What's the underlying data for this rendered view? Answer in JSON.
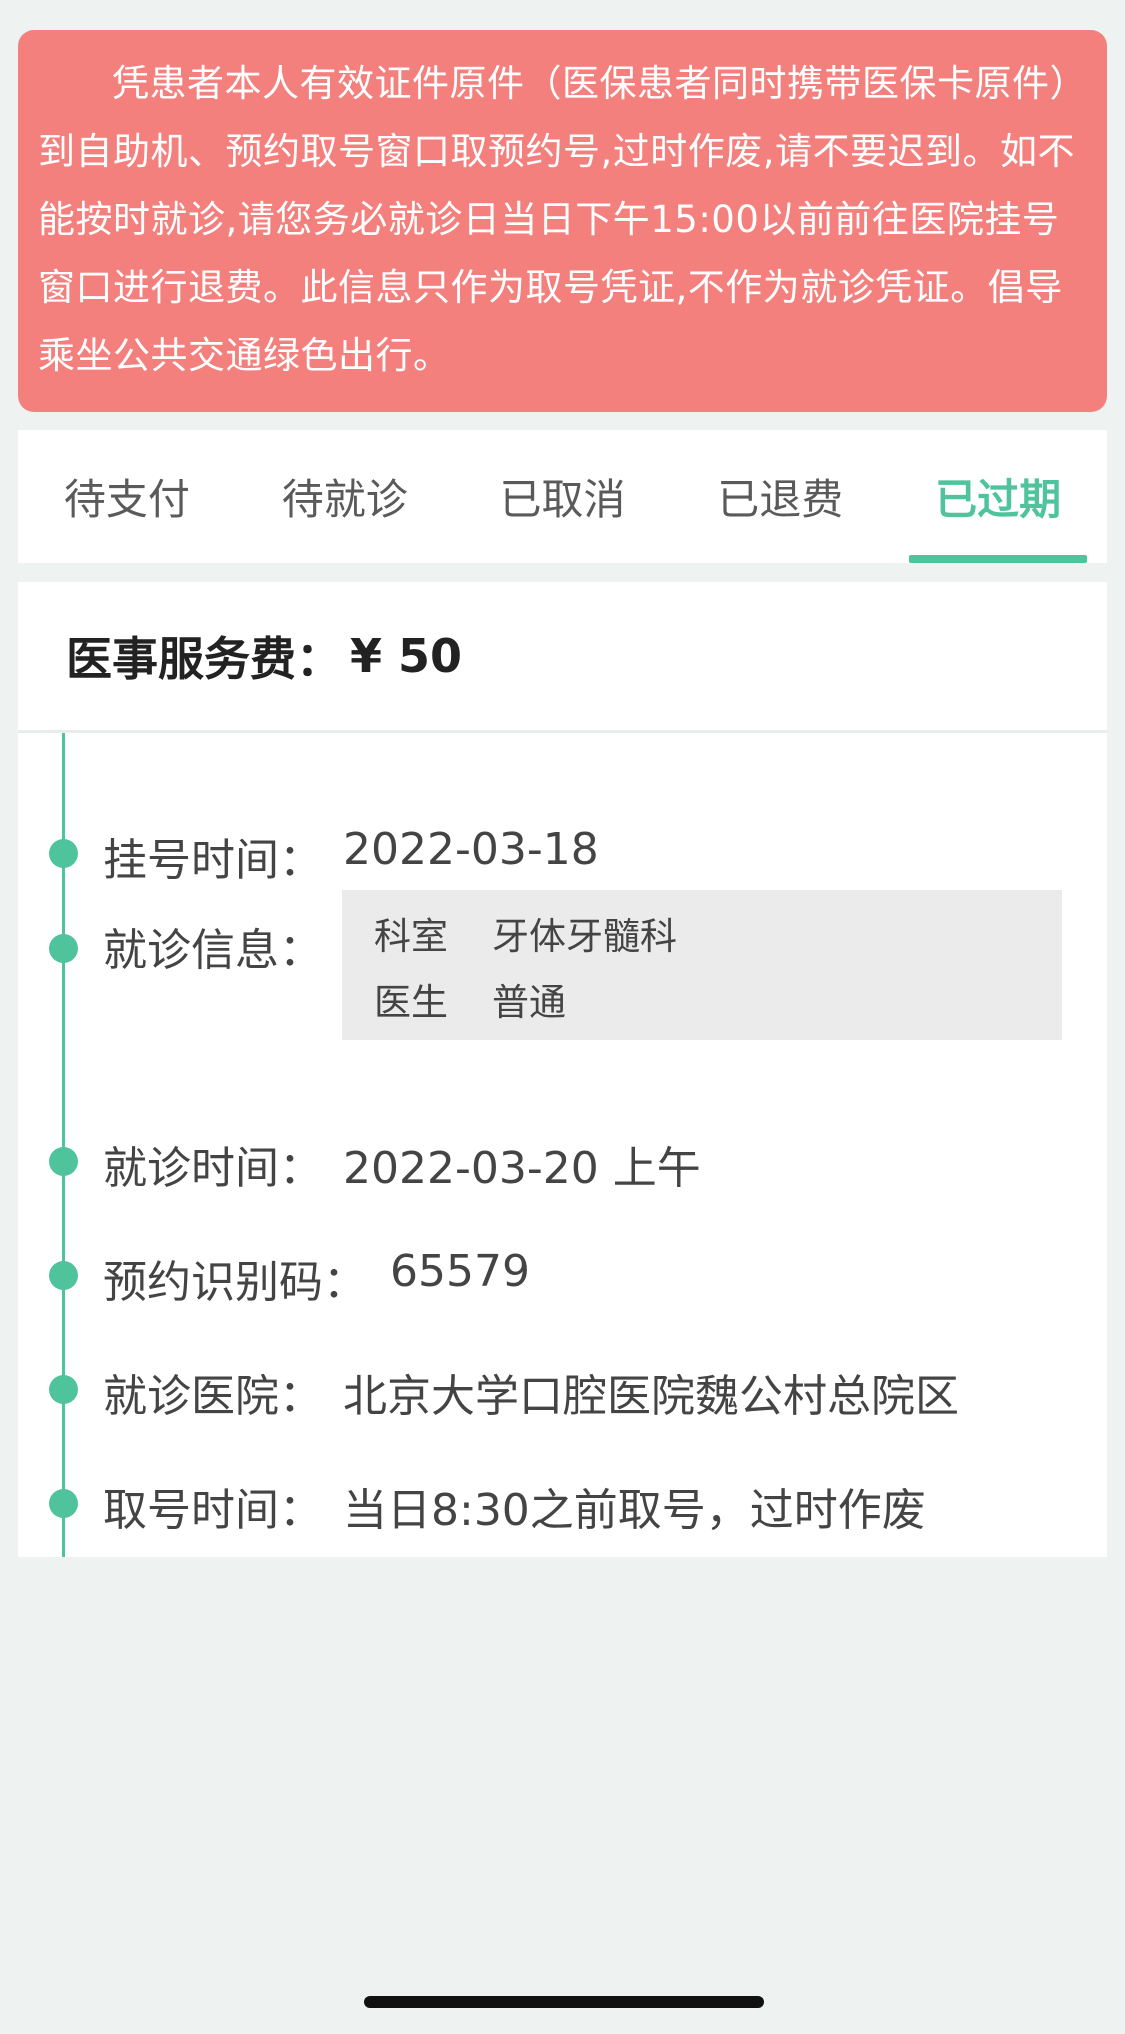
{
  "notice": {
    "text": "凭患者本人有效证件原件（医保患者同时携带医保卡原件）到自助机、预约取号窗口取预约号,过时作废,请不要迟到。如不能按时就诊,请您务必就诊日当日下午15:00以前前往医院挂号窗口进行退费。此信息只作为取号凭证,不作为就诊凭证。倡导乘坐公共交通绿色出行。"
  },
  "tabs": [
    {
      "label": "待支付",
      "active": false
    },
    {
      "label": "待就诊",
      "active": false
    },
    {
      "label": "已取消",
      "active": false
    },
    {
      "label": "已退费",
      "active": false
    },
    {
      "label": "已过期",
      "active": true
    }
  ],
  "fee": {
    "label": "医事服务费：",
    "amount": "¥ 50"
  },
  "details": {
    "register_time": {
      "label": "挂号时间：",
      "value": "2022-03-18"
    },
    "visit_info": {
      "label": "就诊信息：",
      "department_key": "科室",
      "department_value": "牙体牙髓科",
      "doctor_key": "医生",
      "doctor_value": "普通"
    },
    "visit_time": {
      "label": "就诊时间：",
      "value": "2022-03-20 上午"
    },
    "booking_code": {
      "label": "预约识别码：",
      "value": "65579"
    },
    "hospital": {
      "label": "就诊医院：",
      "value": "北京大学口腔医院魏公村总院区"
    },
    "pickup_time": {
      "label": "取号时间：",
      "value": "当日8:30之前取号，过时作废"
    }
  },
  "colors": {
    "accent": "#4fc39b",
    "notice_bg": "#f4807e",
    "page_bg": "#eef2f1"
  }
}
